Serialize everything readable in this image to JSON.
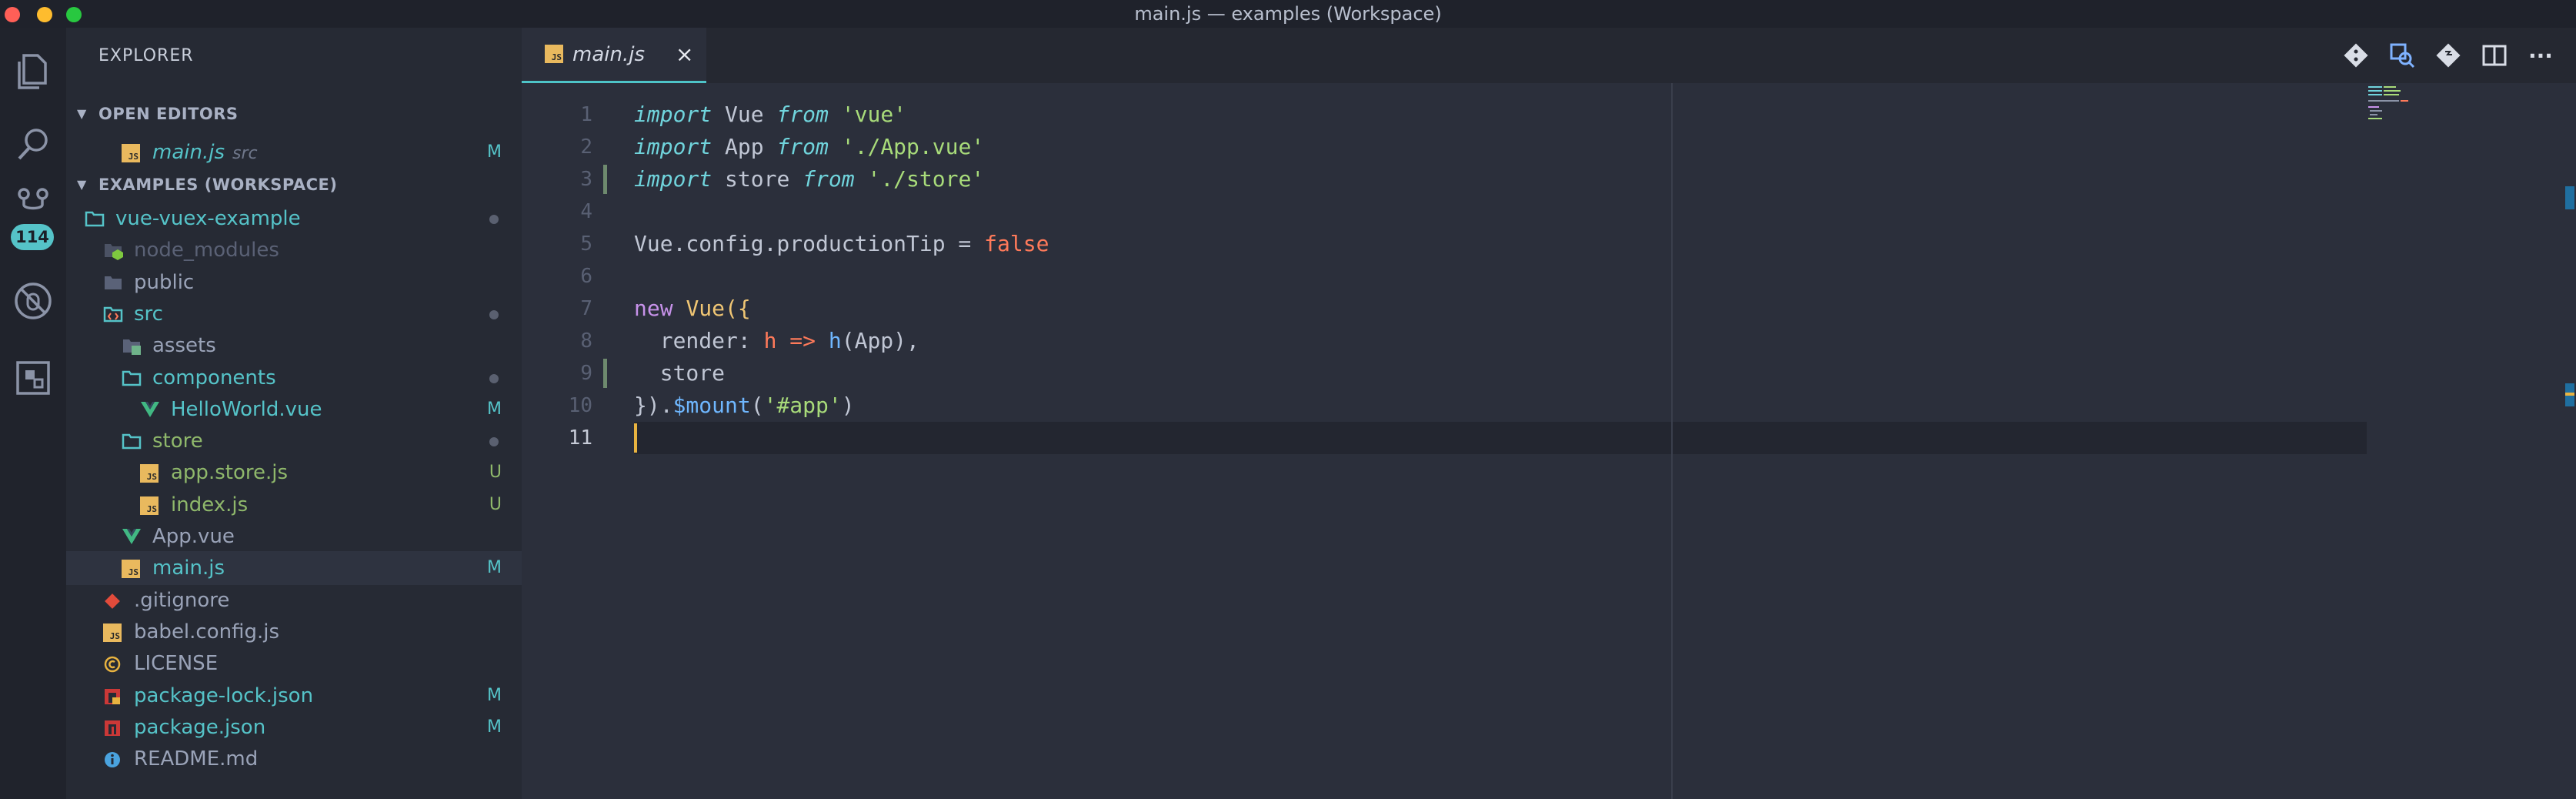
{
  "window": {
    "title": "main.js — examples (Workspace)"
  },
  "activity_bar": {
    "icons": [
      "files-icon",
      "search-icon",
      "source-control-icon",
      "debug-icon",
      "extensions-icon"
    ],
    "source_control_badge": "114"
  },
  "sidebar": {
    "title": "EXPLORER",
    "open_editors": {
      "header": "OPEN EDITORS",
      "items": [
        {
          "name": "main.js",
          "description": "src",
          "status": "M"
        }
      ]
    },
    "workspace": {
      "header": "EXAMPLES (WORKSPACE)",
      "tree": [
        {
          "name": "vue-vuex-example",
          "type": "folder-open",
          "depth": 0,
          "color": "#55c3c8",
          "marker": "dot"
        },
        {
          "name": "node_modules",
          "type": "folder-node",
          "depth": 1,
          "color": "#5a6175",
          "marker": ""
        },
        {
          "name": "public",
          "type": "folder",
          "depth": 1,
          "color": "#9aa3b8",
          "marker": ""
        },
        {
          "name": "src",
          "type": "folder-src",
          "depth": 1,
          "color": "#55c3c8",
          "marker": "dot"
        },
        {
          "name": "assets",
          "type": "folder-assets",
          "depth": 2,
          "color": "#9aa3b8",
          "marker": ""
        },
        {
          "name": "components",
          "type": "folder-open",
          "depth": 2,
          "color": "#55c3c8",
          "marker": "dot"
        },
        {
          "name": "HelloWorld.vue",
          "type": "vue",
          "depth": 3,
          "color": "#55c3c8",
          "marker": "M"
        },
        {
          "name": "store",
          "type": "folder-open",
          "depth": 2,
          "color": "#8fb86b",
          "marker": "dot"
        },
        {
          "name": "app.store.js",
          "type": "js",
          "depth": 3,
          "color": "#8fb86b",
          "marker": "U"
        },
        {
          "name": "index.js",
          "type": "js",
          "depth": 3,
          "color": "#8fb86b",
          "marker": "U"
        },
        {
          "name": "App.vue",
          "type": "vue",
          "depth": 2,
          "color": "#9aa3b8",
          "marker": ""
        },
        {
          "name": "main.js",
          "type": "js",
          "depth": 2,
          "color": "#55c3c8",
          "marker": "M"
        },
        {
          "name": ".gitignore",
          "type": "git",
          "depth": 1,
          "color": "#9aa3b8",
          "marker": ""
        },
        {
          "name": "babel.config.js",
          "type": "js",
          "depth": 1,
          "color": "#9aa3b8",
          "marker": ""
        },
        {
          "name": "LICENSE",
          "type": "license",
          "depth": 1,
          "color": "#9aa3b8",
          "marker": ""
        },
        {
          "name": "package-lock.json",
          "type": "npm-lock",
          "depth": 1,
          "color": "#55c3c8",
          "marker": "M"
        },
        {
          "name": "package.json",
          "type": "npm",
          "depth": 1,
          "color": "#55c3c8",
          "marker": "M"
        },
        {
          "name": "README.md",
          "type": "info",
          "depth": 1,
          "color": "#9aa3b8",
          "marker": ""
        }
      ]
    }
  },
  "editor": {
    "tab": {
      "label": "main.js",
      "close_glyph": "×"
    },
    "toolbar": [
      "git-compare-icon",
      "open-changes-icon",
      "git-commit-icon",
      "split-editor-icon",
      "more-actions-icon"
    ],
    "more_glyph": "···",
    "line_numbers": [
      "1",
      "2",
      "3",
      "4",
      "5",
      "6",
      "7",
      "8",
      "9",
      "10",
      "11"
    ],
    "active_line": 11,
    "modified_lines": [
      3,
      9
    ],
    "lines": [
      [
        {
          "t": "import",
          "c": "kw"
        },
        {
          "t": " Vue ",
          "c": "punc"
        },
        {
          "t": "from",
          "c": "kw"
        },
        {
          "t": " ",
          "c": "punc"
        },
        {
          "t": "'vue'",
          "c": "str"
        }
      ],
      [
        {
          "t": "import",
          "c": "kw"
        },
        {
          "t": " App ",
          "c": "punc"
        },
        {
          "t": "from",
          "c": "kw"
        },
        {
          "t": " ",
          "c": "punc"
        },
        {
          "t": "'./App.vue'",
          "c": "str"
        }
      ],
      [
        {
          "t": "import",
          "c": "kw"
        },
        {
          "t": " store ",
          "c": "punc"
        },
        {
          "t": "from",
          "c": "kw"
        },
        {
          "t": " ",
          "c": "punc"
        },
        {
          "t": "'./store'",
          "c": "str"
        }
      ],
      [],
      [
        {
          "t": "Vue.config.productionTip",
          "c": "punc"
        },
        {
          "t": " = ",
          "c": "punc"
        },
        {
          "t": "false",
          "c": "bool"
        }
      ],
      [],
      [
        {
          "t": "new",
          "c": "newkw"
        },
        {
          "t": " ",
          "c": "punc"
        },
        {
          "t": "Vue",
          "c": "cls"
        },
        {
          "t": "({",
          "c": "cls"
        }
      ],
      [
        {
          "t": "  render: ",
          "c": "punc"
        },
        {
          "t": "h",
          "c": "op"
        },
        {
          "t": " ",
          "c": "punc"
        },
        {
          "t": "=>",
          "c": "op"
        },
        {
          "t": " ",
          "c": "punc"
        },
        {
          "t": "h",
          "c": "fn"
        },
        {
          "t": "(App),",
          "c": "punc"
        }
      ],
      [
        {
          "t": "  store",
          "c": "punc"
        }
      ],
      [
        {
          "t": "}).",
          "c": "punc"
        },
        {
          "t": "$mount",
          "c": "dol"
        },
        {
          "t": "(",
          "c": "punc"
        },
        {
          "t": "'#app'",
          "c": "str"
        },
        {
          "t": ")",
          "c": "punc"
        }
      ],
      []
    ]
  }
}
